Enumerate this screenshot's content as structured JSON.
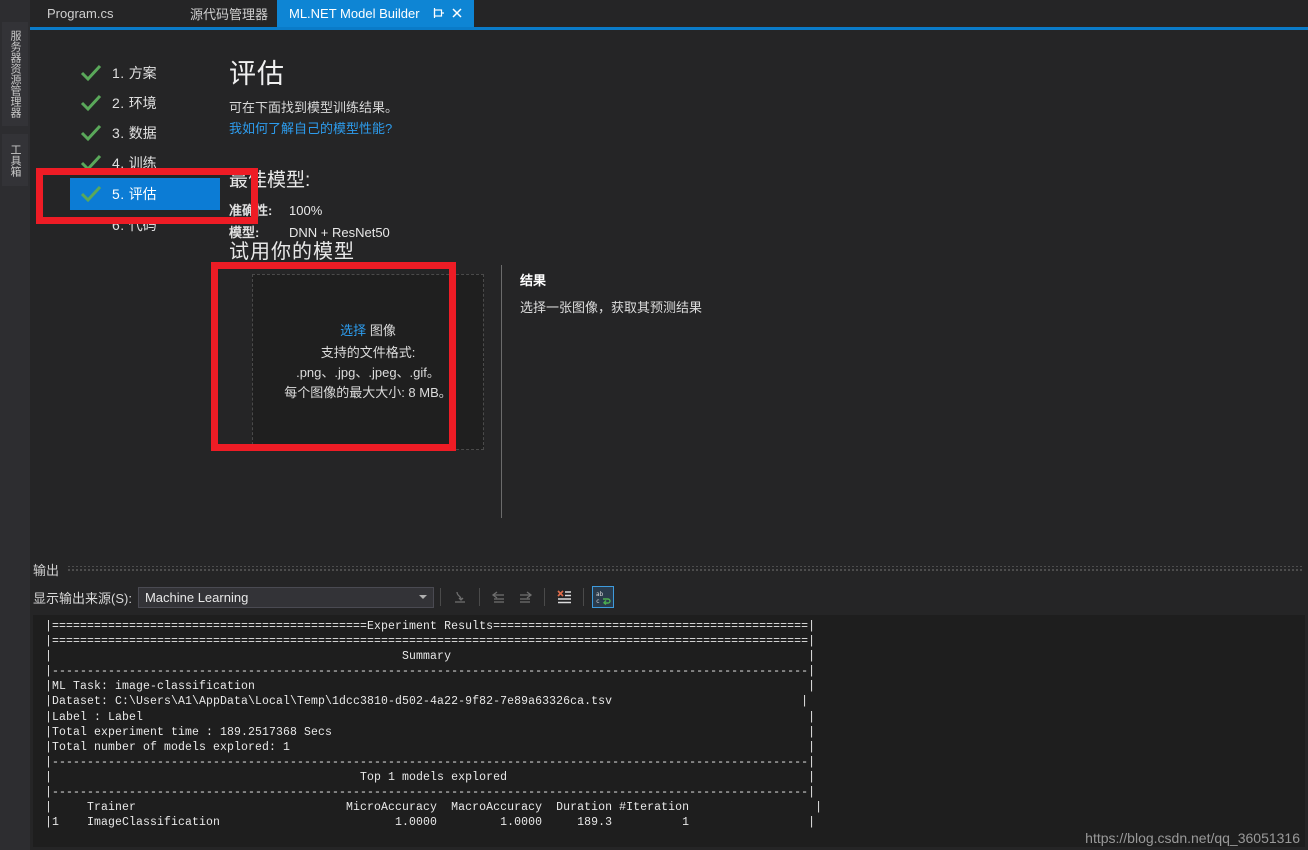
{
  "window": {
    "left_dock": {
      "tabs": [
        {
          "label": "服务器资源管理器",
          "name": "server-explorer"
        },
        {
          "label": "工具箱",
          "name": "toolbox"
        }
      ]
    },
    "tabs": [
      {
        "label": "Program.cs",
        "active": false
      },
      {
        "label": "源代码管理器",
        "active": false
      },
      {
        "label": "ML.NET Model Builder",
        "active": true,
        "pin_icon": "pin-icon",
        "close_icon": "close-icon"
      }
    ]
  },
  "steps": [
    {
      "num": "1.",
      "label": "方案",
      "done": true,
      "active": false
    },
    {
      "num": "2.",
      "label": "环境",
      "done": true,
      "active": false
    },
    {
      "num": "3.",
      "label": "数据",
      "done": true,
      "active": false
    },
    {
      "num": "4.",
      "label": "训练",
      "done": true,
      "active": false
    },
    {
      "num": "5.",
      "label": "评估",
      "done": true,
      "active": true
    },
    {
      "num": "6.",
      "label": "代码",
      "done": false,
      "active": false
    }
  ],
  "evaluate": {
    "title": "评估",
    "description": "可在下面找到模型训练结果。",
    "help_link": "我如何了解自己的模型性能?",
    "best_model_title": "最佳模型:",
    "metrics": [
      {
        "label": "准确性:",
        "value": "100%"
      },
      {
        "label": "模型:",
        "value": "DNN + ResNet50"
      }
    ]
  },
  "try_model": {
    "title": "试用你的模型",
    "dropzone": {
      "pick_link": "选择",
      "pick_rest": "图像",
      "formats_label": "支持的文件格式:",
      "formats": ".png、.jpg、.jpeg、.gif。",
      "max_size": "每个图像的最大大小: 8 MB。"
    }
  },
  "results": {
    "title": "结果",
    "description": "选择一张图像，获取其预测结果"
  },
  "output_panel": {
    "title": "输出",
    "source_label": "显示输出来源(S):",
    "source_value": "Machine Learning",
    "toolbar_buttons": [
      {
        "name": "jump-to-message-icon",
        "glyph": "⤶",
        "selected": false,
        "disabled": true
      },
      {
        "name": "previous-message-icon",
        "glyph": "⇐",
        "selected": false,
        "disabled": true
      },
      {
        "name": "next-message-icon",
        "glyph": "⇒",
        "selected": false,
        "disabled": true
      },
      {
        "name": "clear-all-icon",
        "glyph": "✕",
        "selected": false,
        "disabled": false
      },
      {
        "name": "toggle-word-wrap-icon",
        "glyph": "ab",
        "selected": true,
        "disabled": false
      }
    ],
    "console_text": "|=============================================Experiment Results=============================================|\n|============================================================================================================|\n|                                                  Summary                                                   |\n|------------------------------------------------------------------------------------------------------------|\n|ML Task: image-classification                                                                               |\n|Dataset: C:\\Users\\A1\\AppData\\Local\\Temp\\1dcc3810-d502-4a22-9f82-7e89a63326ca.tsv                           |\n|Label : Label                                                                                               |\n|Total experiment time : 189.2517368 Secs                                                                    |\n|Total number of models explored: 1                                                                          |\n|------------------------------------------------------------------------------------------------------------|\n|                                            Top 1 models explored                                           |\n|------------------------------------------------------------------------------------------------------------|\n|     Trainer                              MicroAccuracy  MacroAccuracy  Duration #Iteration                  |\n|1    ImageClassification                         1.0000         1.0000     189.3          1                 |"
  },
  "watermark": "https://blog.csdn.net/qq_36051316",
  "colors": {
    "accent_blue": "#0c7cd5",
    "link_blue": "#2d9ced",
    "annotation_red": "#ee1c25",
    "check_green": "#5aa85a",
    "panel_bg": "#252526",
    "console_bg": "#1e1e1e"
  }
}
